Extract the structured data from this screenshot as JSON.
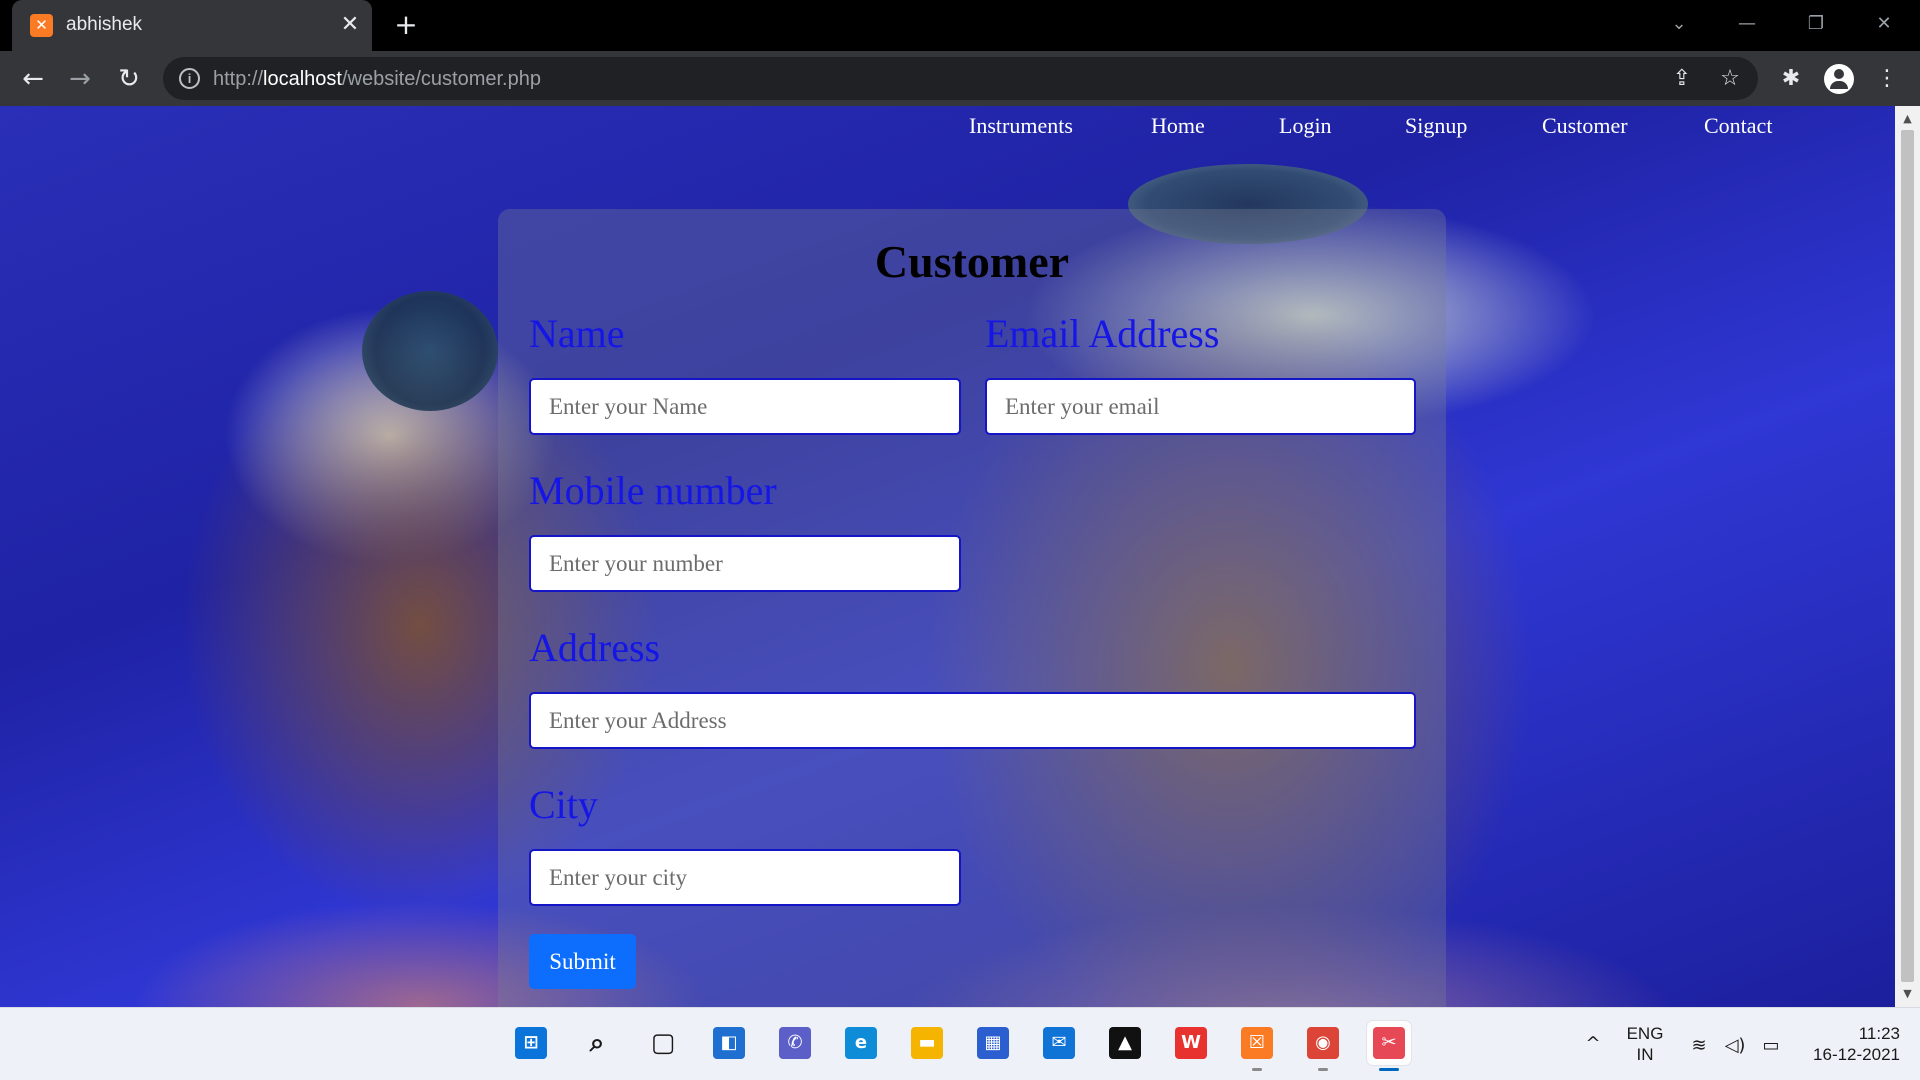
{
  "browser": {
    "tab_title": "abhishek",
    "tab_favicon": "xampp-icon",
    "close_glyph": "✕",
    "new_tab_glyph": "+",
    "url_scheme": "http://",
    "url_host": "localhost",
    "url_path": "/website/customer.php",
    "window_controls": [
      "⌄",
      "—",
      "❐",
      "✕"
    ],
    "nav_glyphs": {
      "back": "←",
      "forward": "→",
      "reload": "↻"
    },
    "toolbar_glyphs": {
      "share": "⇪",
      "bookmark": "☆",
      "extensions": "✱",
      "menu": "⋮"
    }
  },
  "site_nav": {
    "items": [
      "Instruments",
      "Home",
      "Login",
      "Signup",
      "Customer",
      "Contact"
    ]
  },
  "form": {
    "title": "Customer",
    "name_label": "Name",
    "name_placeholder": "Enter your Name",
    "email_label": "Email Address",
    "email_placeholder": "Enter your email",
    "mobile_label": "Mobile number",
    "mobile_placeholder": "Enter your number",
    "address_label": "Address",
    "address_placeholder": "Enter your Address",
    "city_label": "City",
    "city_placeholder": "Enter your city",
    "submit_label": "Submit"
  },
  "scrollbar": {
    "up": "▲",
    "down": "▼"
  },
  "taskbar": {
    "apps": [
      {
        "name": "start",
        "glyph": "⊞",
        "color": "#0a74da",
        "active": false,
        "running": false
      },
      {
        "name": "search",
        "glyph": "⌕",
        "color": "#1a1a1a",
        "active": false,
        "running": false
      },
      {
        "name": "task-view",
        "glyph": "▢",
        "color": "#1a1a1a",
        "active": false,
        "running": false
      },
      {
        "name": "widgets",
        "glyph": "◧",
        "color": "#1f6fd1",
        "active": false,
        "running": false
      },
      {
        "name": "chat",
        "glyph": "✆",
        "color": "#5b5fc7",
        "active": false,
        "running": false
      },
      {
        "name": "edge",
        "glyph": "e",
        "color": "#0f8cd8",
        "active": false,
        "running": false
      },
      {
        "name": "file-explorer",
        "glyph": "▬",
        "color": "#f4b400",
        "active": false,
        "running": false
      },
      {
        "name": "store",
        "glyph": "▦",
        "color": "#2b5fcf",
        "active": false,
        "running": false
      },
      {
        "name": "mail",
        "glyph": "✉",
        "color": "#1073d6",
        "active": false,
        "running": false
      },
      {
        "name": "inkscape",
        "glyph": "▲",
        "color": "#111111",
        "active": false,
        "running": false
      },
      {
        "name": "wps-office",
        "glyph": "W",
        "color": "#e8322f",
        "active": false,
        "running": false
      },
      {
        "name": "xampp",
        "glyph": "☒",
        "color": "#fb7a24",
        "active": false,
        "running": true
      },
      {
        "name": "chrome",
        "glyph": "◉",
        "color": "#db4437",
        "active": false,
        "running": true
      },
      {
        "name": "snipping-tool",
        "glyph": "✂",
        "color": "#e74856",
        "active": true,
        "running": true
      }
    ],
    "chevron_glyph": "^",
    "language_line1": "ENG",
    "language_line2": "IN",
    "tray_glyphs": {
      "wifi": "≋",
      "volume": "◁)",
      "battery": "▭"
    },
    "time": "11:23",
    "date": "16-12-2021"
  }
}
